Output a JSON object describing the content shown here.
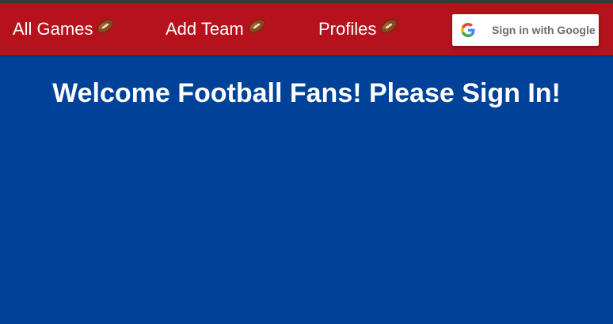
{
  "nav": {
    "links": [
      {
        "label": "All Games",
        "icon": "football-icon"
      },
      {
        "label": "Add Team",
        "icon": "football-icon"
      },
      {
        "label": "Profiles",
        "icon": "football-icon"
      }
    ],
    "sign_in": {
      "label": "Sign in with Google",
      "icon": "google-logo-icon"
    }
  },
  "main": {
    "headline": "Welcome Football Fans! Please Sign In!"
  },
  "colors": {
    "navbar": "#b5121b",
    "background": "#00419a",
    "text": "#ffffff"
  }
}
